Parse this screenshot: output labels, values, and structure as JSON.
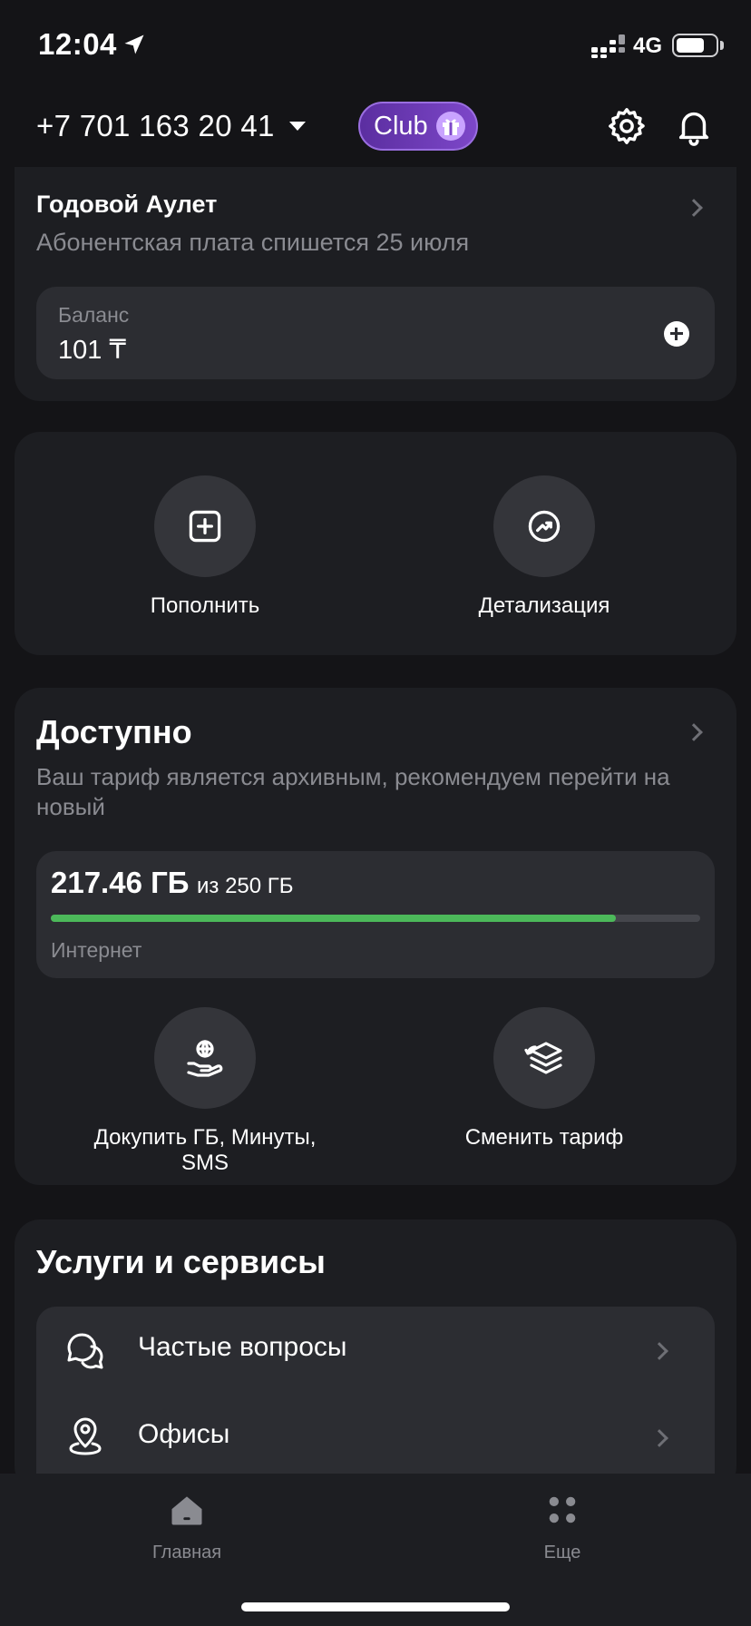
{
  "status_bar": {
    "time": "12:04",
    "network": "4G"
  },
  "header": {
    "phone": "+7 701 163 20 41",
    "club_label": "Club"
  },
  "plan": {
    "title": "Годовой Аулет",
    "subtitle": "Абонентская плата спишется 25 июля",
    "balance_label": "Баланс",
    "balance_value": "101 ₸"
  },
  "actions": [
    {
      "label": "Пополнить",
      "icon": "plus-square-icon"
    },
    {
      "label": "Детализация",
      "icon": "trend-chart-icon"
    }
  ],
  "available": {
    "title": "Доступно",
    "subtitle": "Ваш тариф является архивным, рекомендуем перейти на новый",
    "usage": {
      "used": "217.46 ГБ",
      "total": "из 250 ГБ",
      "label": "Интернет",
      "fraction": 0.87
    },
    "actions": [
      {
        "label": "Докупить ГБ, Минуты, SMS",
        "icon": "globe-hand-icon"
      },
      {
        "label": "Сменить тариф",
        "icon": "layers-swap-icon"
      }
    ]
  },
  "services": {
    "title": "Услуги и сервисы",
    "items": [
      {
        "label": "Частые вопросы",
        "icon": "chat-bubbles-icon"
      },
      {
        "label": "Офисы",
        "icon": "location-pin-icon"
      }
    ]
  },
  "tab_bar": {
    "tabs": [
      {
        "label": "Главная",
        "icon": "home-icon"
      },
      {
        "label": "Еще",
        "icon": "grid-dots-icon"
      }
    ]
  },
  "colors": {
    "background": "#141417",
    "card": "#1d1e22",
    "accent_green": "#4cb95a",
    "club_purple": "#7d47c9"
  }
}
